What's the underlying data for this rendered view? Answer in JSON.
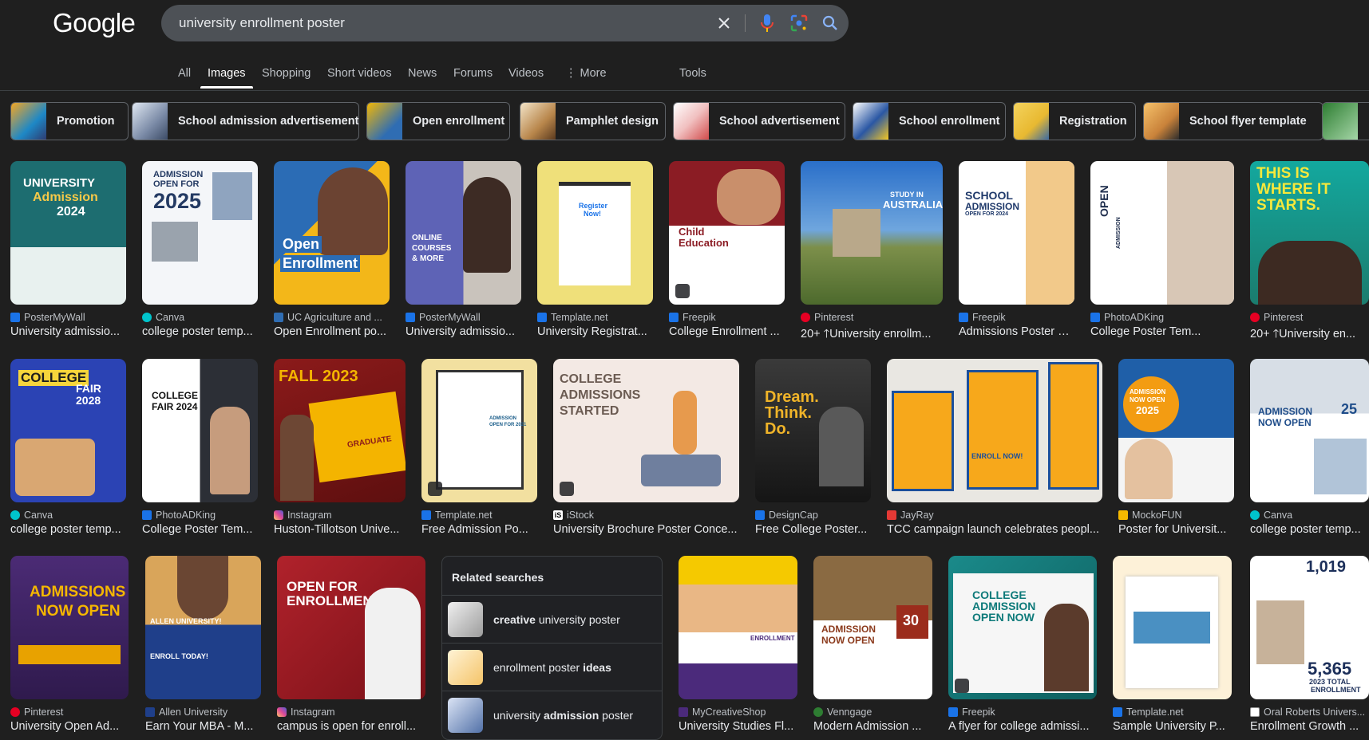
{
  "logo": "Google",
  "search": {
    "query": "university enrollment poster"
  },
  "tabs": [
    {
      "label": "All"
    },
    {
      "label": "Images"
    },
    {
      "label": "Shopping"
    },
    {
      "label": "Short videos"
    },
    {
      "label": "News"
    },
    {
      "label": "Forums"
    },
    {
      "label": "Videos"
    },
    {
      "label": "More"
    },
    {
      "label": "Tools"
    }
  ],
  "chips": [
    {
      "label": "Promotion"
    },
    {
      "label": "School admission advertisement"
    },
    {
      "label": "Open enrollment"
    },
    {
      "label": "Pamphlet design"
    },
    {
      "label": "School advertisement"
    },
    {
      "label": "School enrollment"
    },
    {
      "label": "Registration"
    },
    {
      "label": "School flyer template"
    }
  ],
  "results": [
    {
      "source": "PosterMyWall",
      "title": "University admissio...",
      "poster": [
        "UNIVERSITY",
        "Admission",
        "2024"
      ]
    },
    {
      "source": "Canva",
      "title": "college poster temp...",
      "poster": [
        "ADMISSION",
        "OPEN FOR",
        "2025"
      ]
    },
    {
      "source": "UC Agriculture and ...",
      "title": "Open Enrollment po...",
      "poster": [
        "Open",
        "Enrollment"
      ]
    },
    {
      "source": "PosterMyWall",
      "title": "University admissio...",
      "poster": [
        "ONLINE",
        "COURSES",
        "& MORE"
      ]
    },
    {
      "source": "Template.net",
      "title": "University Registrat...",
      "poster": [
        "Register",
        "Now!"
      ]
    },
    {
      "source": "Freepik",
      "title": "College Enrollment ...",
      "poster": [
        "Child",
        "Education"
      ]
    },
    {
      "source": "Pinterest",
      "title": "20+ 🡑University enrollm...",
      "poster": [
        "STUDY IN",
        "AUSTRALIA"
      ]
    },
    {
      "source": "Freepik",
      "title": "Admissions Poster PSD, ...",
      "poster": [
        "SCHOOL",
        "ADMISSION",
        "OPEN FOR 2024"
      ]
    },
    {
      "source": "PhotoADKing",
      "title": "College Poster Tem...",
      "poster": [
        "OPEN",
        "ADMISSION"
      ]
    },
    {
      "source": "Pinterest",
      "title": "20+ 🡑University en...",
      "poster": [
        "THIS IS",
        "WHERE IT",
        "STARTS."
      ]
    },
    {
      "source": "Canva",
      "title": "college poster temp...",
      "poster": [
        "COLLEGE",
        "FAIR 2028"
      ]
    },
    {
      "source": "PhotoADKing",
      "title": "College Poster Tem...",
      "poster": [
        "COLLEGE",
        "FAIR 2024"
      ]
    },
    {
      "source": "Instagram",
      "title": "Huston-Tillotson Unive...",
      "poster": [
        "FALL 2023",
        "GRADUATE"
      ]
    },
    {
      "source": "Template.net",
      "title": "Free Admission Po...",
      "poster": [
        "ADMISSION",
        "OPEN FOR 2021"
      ]
    },
    {
      "source": "iStock",
      "title": "University Brochure Poster Conce...",
      "poster": [
        "COLLEGE",
        "ADMISSIONS",
        "STARTED"
      ]
    },
    {
      "source": "DesignCap",
      "title": "Free College Poster...",
      "poster": [
        "Dream.",
        "Think.",
        "Do."
      ]
    },
    {
      "source": "JayRay",
      "title": "TCC campaign launch celebrates peopl...",
      "poster": [
        "ENROLL NOW!"
      ]
    },
    {
      "source": "MockoFUN",
      "title": "Poster for Universit...",
      "poster": [
        "ADMISSION",
        "NOW OPEN",
        "2025"
      ]
    },
    {
      "source": "Canva",
      "title": "college poster temp...",
      "poster": [
        "ADMISSION",
        "NOW OPEN",
        "25"
      ]
    },
    {
      "source": "Pinterest",
      "title": "University Open Ad...",
      "poster": [
        "ADMISSIONS",
        "NOW OPEN"
      ]
    },
    {
      "source": "Allen University",
      "title": "Earn Your MBA - M...",
      "poster": [
        "ALLEN UNIVERSITY!",
        "ENROLL TODAY!"
      ]
    },
    {
      "source": "Instagram",
      "title": "campus is open for enroll...",
      "poster": [
        "OPEN FOR",
        "ENROLLMENT"
      ]
    },
    {
      "source": "MyCreativeShop",
      "title": "University Studies Fl...",
      "poster": [
        "ENROLLMENT"
      ]
    },
    {
      "source": "Venngage",
      "title": "Modern Admission ...",
      "poster": [
        "ADMISSION",
        "NOW OPEN",
        "30"
      ]
    },
    {
      "source": "Freepik",
      "title": "A flyer for college admissi...",
      "poster": [
        "COLLEGE",
        "ADMISSION",
        "OPEN NOW"
      ]
    },
    {
      "source": "Template.net",
      "title": "Sample University P...",
      "poster": []
    },
    {
      "source": "Oral Roberts Univers...",
      "title": "Enrollment Growth ...",
      "poster": [
        "1,019",
        "5,365",
        "2023 TOTAL",
        "ENROLLMENT"
      ]
    }
  ],
  "related": {
    "heading": "Related searches",
    "items": [
      {
        "pre": "creative",
        "post": " university poster"
      },
      {
        "pre": "enrollment poster ",
        "bold_post": "ideas"
      },
      {
        "pre": "university ",
        "bold_mid": "admission",
        "post": " poster"
      }
    ]
  },
  "colors": {
    "background": "#1f1f1f",
    "searchbar": "#4d5156",
    "accent_blue": "#8ab4f8"
  }
}
